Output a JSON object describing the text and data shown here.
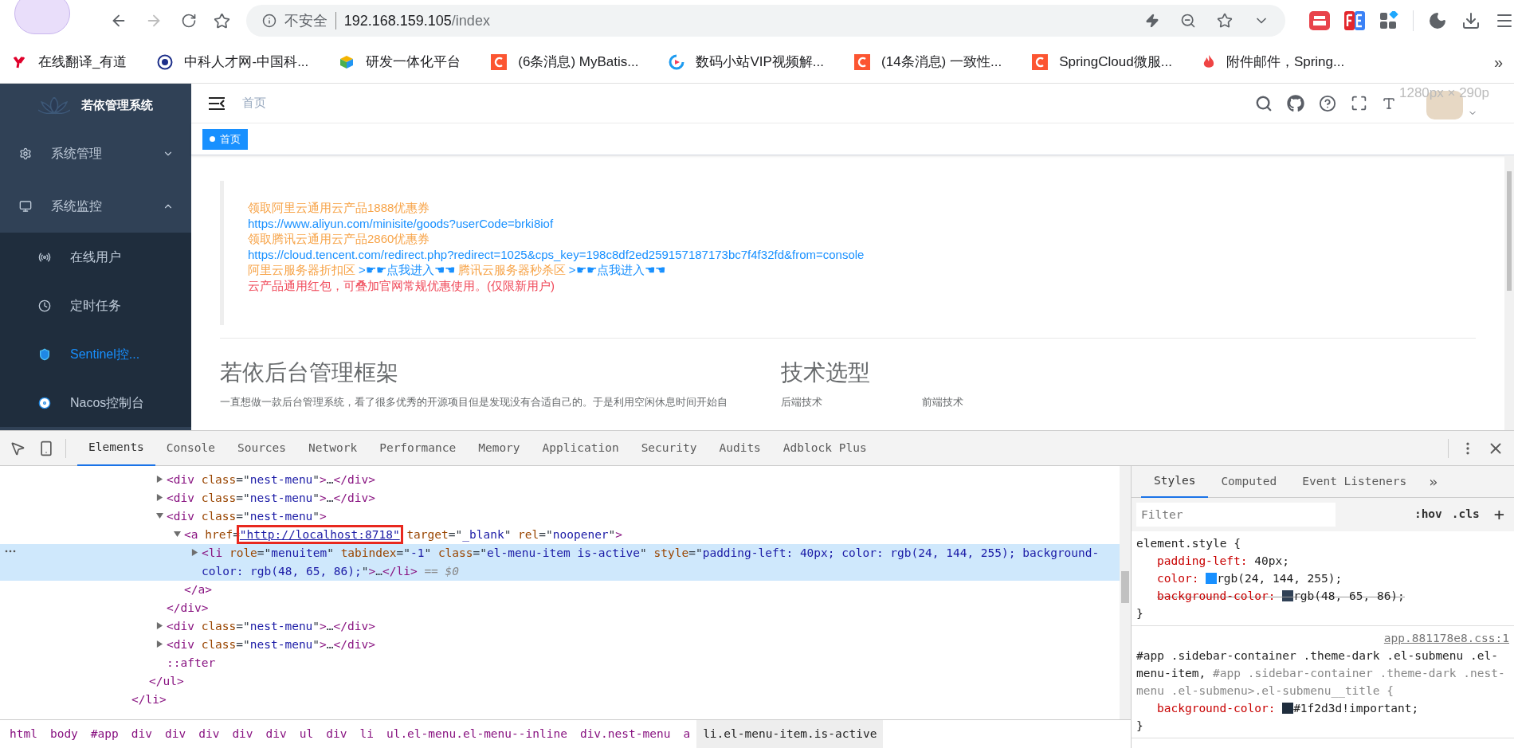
{
  "browser": {
    "security_label": "不安全",
    "url_host": "192.168.159.105",
    "url_path": "/index",
    "bookmarks": [
      {
        "kind": "youdao",
        "label": "在线翻译_有道"
      },
      {
        "kind": "seal",
        "label": "中科人才网-中国科..."
      },
      {
        "kind": "cube",
        "label": "研发一体化平台"
      },
      {
        "kind": "csdn",
        "label": "(6条消息) MyBatis..."
      },
      {
        "kind": "play",
        "label": "数码小站VIP视频解..."
      },
      {
        "kind": "csdn",
        "label": "(14条消息) 一致性..."
      },
      {
        "kind": "csdn",
        "label": "SpringCloud微服..."
      },
      {
        "kind": "flame",
        "label": "附件邮件，Spring..."
      }
    ],
    "bookmarks_more": "»"
  },
  "app": {
    "logo_title": "若依管理系统",
    "sidebar": [
      {
        "kind": "gear",
        "label": "系统管理",
        "expanded": false,
        "selected": false
      },
      {
        "kind": "monitor",
        "label": "系统监控",
        "expanded": true,
        "selected": false,
        "children": [
          {
            "kind": "waves",
            "label": "在线用户",
            "selected": false
          },
          {
            "kind": "timer",
            "label": "定时任务",
            "selected": false
          },
          {
            "kind": "shield",
            "label": "Sentinel控...",
            "selected": true
          },
          {
            "kind": "disc",
            "label": "Nacos控制台",
            "selected": false
          }
        ]
      }
    ],
    "breadcrumb": "首页",
    "tags": [
      {
        "label": "首页",
        "selected": true
      }
    ],
    "size_overlay": "1280px × 290p",
    "notice": [
      [
        {
          "kind": "orange",
          "text": "领取阿里云通用云产品1888优惠券"
        }
      ],
      [
        {
          "kind": "link",
          "text": "https://www.aliyun.com/minisite/goods?userCode=brki8iof"
        }
      ],
      [
        {
          "kind": "orange",
          "text": "领取腾讯云通用云产品2860优惠券"
        }
      ],
      [
        {
          "kind": "link",
          "text": "https://cloud.tencent.com/redirect.php?redirect=1025&cps_key=198c8df2ed259157187173bc7f4f32fd&from=console"
        }
      ],
      [
        {
          "kind": "orange",
          "text": "阿里云服务器折扣区"
        },
        {
          "kind": "link",
          "text": ">☛☛点我进入☚☚"
        },
        {
          "kind": "orange",
          "text": "腾讯云服务器秒杀区"
        },
        {
          "kind": "link",
          "text": ">☛☛点我进入☚☚"
        }
      ],
      [
        {
          "kind": "red",
          "text": "云产品通用红包，可叠加官网常规优惠使用。(仅限新用户)"
        }
      ]
    ],
    "intro_title": "若依后台管理框架",
    "intro_text": "一直想做一款后台管理系统，看了很多优秀的开源项目但是发现没有合适自己的。于是利用空闲休息时间开始自",
    "tech_title": "技术选型",
    "tech_columns": [
      "后端技术",
      "前端技术"
    ]
  },
  "devtools": {
    "tabs": [
      {
        "label": "Elements",
        "selected": true
      },
      {
        "label": "Console",
        "selected": false
      },
      {
        "label": "Sources",
        "selected": false
      },
      {
        "label": "Network",
        "selected": false
      },
      {
        "label": "Performance",
        "selected": false
      },
      {
        "label": "Memory",
        "selected": false
      },
      {
        "label": "Application",
        "selected": false
      },
      {
        "label": "Security",
        "selected": false
      },
      {
        "label": "Audits",
        "selected": false
      },
      {
        "label": "Adblock Plus",
        "selected": false
      }
    ],
    "tree": [
      {
        "close": [
          {
            "kind": "tag",
            "text": "</li>"
          }
        ],
        "children": [
          {
            "close": [
              {
                "kind": "tag",
                "text": "</ul>"
              }
            ],
            "children": [
              {
                "kind": "element",
                "expanded": false,
                "selected": false,
                "open": [
                  {
                    "kind": "tag",
                    "text": "<div"
                  },
                  {
                    "kind": "attr",
                    "text": " class"
                  },
                  {
                    "kind": "plain",
                    "text": "=\""
                  },
                  {
                    "kind": "value",
                    "text": "nest-menu"
                  },
                  {
                    "kind": "plain",
                    "text": "\""
                  },
                  {
                    "kind": "tag",
                    "text": ">"
                  },
                  {
                    "kind": "plain",
                    "text": "…"
                  },
                  {
                    "kind": "tag",
                    "text": "</div>"
                  }
                ]
              },
              {
                "kind": "element",
                "expanded": false,
                "selected": false,
                "open": [
                  {
                    "kind": "tag",
                    "text": "<div"
                  },
                  {
                    "kind": "attr",
                    "text": " class"
                  },
                  {
                    "kind": "plain",
                    "text": "=\""
                  },
                  {
                    "kind": "value",
                    "text": "nest-menu"
                  },
                  {
                    "kind": "plain",
                    "text": "\""
                  },
                  {
                    "kind": "tag",
                    "text": ">"
                  },
                  {
                    "kind": "plain",
                    "text": "…"
                  },
                  {
                    "kind": "tag",
                    "text": "</div>"
                  }
                ]
              },
              {
                "kind": "element",
                "expanded": true,
                "selected": false,
                "open": [
                  {
                    "kind": "tag",
                    "text": "<div"
                  },
                  {
                    "kind": "attr",
                    "text": " class"
                  },
                  {
                    "kind": "plain",
                    "text": "=\""
                  },
                  {
                    "kind": "value",
                    "text": "nest-menu"
                  },
                  {
                    "kind": "plain",
                    "text": "\""
                  },
                  {
                    "kind": "tag",
                    "text": ">"
                  }
                ],
                "close": [
                  {
                    "kind": "tag",
                    "text": "</div>"
                  }
                ],
                "children": [
                  {
                    "kind": "element",
                    "expanded": true,
                    "selected": false,
                    "open": [
                      {
                        "kind": "tag",
                        "text": "<a"
                      },
                      {
                        "kind": "attr",
                        "text": " href"
                      },
                      {
                        "kind": "plain",
                        "text": "="
                      },
                      {
                        "kind": "boxed-link",
                        "text": "\"http://localhost:8718\""
                      },
                      {
                        "kind": "attr",
                        "text": " target"
                      },
                      {
                        "kind": "plain",
                        "text": "=\""
                      },
                      {
                        "kind": "value",
                        "text": "_blank"
                      },
                      {
                        "kind": "plain",
                        "text": "\""
                      },
                      {
                        "kind": "attr",
                        "text": " rel"
                      },
                      {
                        "kind": "plain",
                        "text": "=\""
                      },
                      {
                        "kind": "value",
                        "text": "noopener"
                      },
                      {
                        "kind": "plain",
                        "text": "\""
                      },
                      {
                        "kind": "tag",
                        "text": ">"
                      }
                    ],
                    "close": [
                      {
                        "kind": "tag",
                        "text": "</a>"
                      }
                    ],
                    "children": [
                      {
                        "kind": "element",
                        "expanded": false,
                        "selected": true,
                        "open": [
                          {
                            "kind": "tag",
                            "text": "<li"
                          },
                          {
                            "kind": "attr",
                            "text": " role"
                          },
                          {
                            "kind": "plain",
                            "text": "=\""
                          },
                          {
                            "kind": "value",
                            "text": "menuitem"
                          },
                          {
                            "kind": "plain",
                            "text": "\""
                          },
                          {
                            "kind": "attr",
                            "text": " tabindex"
                          },
                          {
                            "kind": "plain",
                            "text": "=\""
                          },
                          {
                            "kind": "value",
                            "text": "-1"
                          },
                          {
                            "kind": "plain",
                            "text": "\""
                          },
                          {
                            "kind": "attr",
                            "text": " class"
                          },
                          {
                            "kind": "plain",
                            "text": "=\""
                          },
                          {
                            "kind": "value",
                            "text": "el-menu-item is-active"
                          },
                          {
                            "kind": "plain",
                            "text": "\""
                          },
                          {
                            "kind": "attr",
                            "text": " style"
                          },
                          {
                            "kind": "plain",
                            "text": "=\""
                          },
                          {
                            "kind": "value",
                            "text": "padding-left: 40px; color: rgb(24, 144, 255); background-color: rgb(48, 65, 86);"
                          },
                          {
                            "kind": "plain",
                            "text": "\""
                          },
                          {
                            "kind": "tag",
                            "text": ">"
                          },
                          {
                            "kind": "plain",
                            "text": "…"
                          },
                          {
                            "kind": "tag",
                            "text": "</li>"
                          },
                          {
                            "kind": "dim",
                            "text": " == $0"
                          }
                        ]
                      }
                    ]
                  }
                ]
              },
              {
                "kind": "element",
                "expanded": false,
                "selected": false,
                "open": [
                  {
                    "kind": "tag",
                    "text": "<div"
                  },
                  {
                    "kind": "attr",
                    "text": " class"
                  },
                  {
                    "kind": "plain",
                    "text": "=\""
                  },
                  {
                    "kind": "value",
                    "text": "nest-menu"
                  },
                  {
                    "kind": "plain",
                    "text": "\""
                  },
                  {
                    "kind": "tag",
                    "text": ">"
                  },
                  {
                    "kind": "plain",
                    "text": "…"
                  },
                  {
                    "kind": "tag",
                    "text": "</div>"
                  }
                ]
              },
              {
                "kind": "element",
                "expanded": false,
                "selected": false,
                "open": [
                  {
                    "kind": "tag",
                    "text": "<div"
                  },
                  {
                    "kind": "attr",
                    "text": " class"
                  },
                  {
                    "kind": "plain",
                    "text": "=\""
                  },
                  {
                    "kind": "value",
                    "text": "nest-menu"
                  },
                  {
                    "kind": "plain",
                    "text": "\""
                  },
                  {
                    "kind": "tag",
                    "text": ">"
                  },
                  {
                    "kind": "plain",
                    "text": "…"
                  },
                  {
                    "kind": "tag",
                    "text": "</div>"
                  }
                ]
              },
              {
                "kind": "pseudo",
                "selected": false,
                "open": [
                  {
                    "kind": "tag",
                    "text": "::after"
                  }
                ]
              }
            ]
          }
        ]
      }
    ],
    "breadcrumbs": [
      {
        "label": "html",
        "selected": false
      },
      {
        "label": "body",
        "selected": false
      },
      {
        "label": "#app",
        "selected": false
      },
      {
        "label": "div",
        "selected": false
      },
      {
        "label": "div",
        "selected": false
      },
      {
        "label": "div",
        "selected": false
      },
      {
        "label": "div",
        "selected": false
      },
      {
        "label": "div",
        "selected": false
      },
      {
        "label": "ul",
        "selected": false
      },
      {
        "label": "div",
        "selected": false
      },
      {
        "label": "li",
        "selected": false
      },
      {
        "label": "ul.el-menu.el-menu--inline",
        "selected": false
      },
      {
        "label": "div.nest-menu",
        "selected": false
      },
      {
        "label": "a",
        "selected": false
      },
      {
        "label": "li.el-menu-item.is-active",
        "selected": true
      }
    ],
    "styles_tabs": [
      {
        "label": "Styles",
        "selected": true
      },
      {
        "label": "Computed",
        "selected": false
      },
      {
        "label": "Event Listeners",
        "selected": false
      }
    ],
    "styles_more": "»",
    "filter_placeholder": "Filter",
    "hov": ":hov",
    "cls": ".cls",
    "add": "+",
    "rules": [
      {
        "selector": [
          {
            "text": "element.style {",
            "matched": true
          }
        ],
        "declarations": [
          {
            "name": "padding-left:",
            "value": "40px;",
            "struck": false
          },
          {
            "name": "color:",
            "color": "#1890ff",
            "value": "rgb(24, 144, 255);",
            "struck": false
          },
          {
            "name": "background-color:",
            "color": "#304156",
            "value": "rgb(48, 65, 86);",
            "struck": true
          }
        ],
        "close": "}"
      },
      {
        "source": "app.881178e8.css:1",
        "selector": [
          {
            "text": "#app .sidebar-container .theme-dark .el-submenu .el-menu-item,",
            "matched": true
          },
          {
            "text": "#app .sidebar-container .theme-dark .nest-menu .el-submenu>.el-submenu__title {",
            "matched": false
          }
        ],
        "declarations": [
          {
            "name": "background-color:",
            "color": "#1f2d3d",
            "value": "#1f2d3d!important;",
            "struck": false
          }
        ],
        "close": "}"
      }
    ]
  }
}
